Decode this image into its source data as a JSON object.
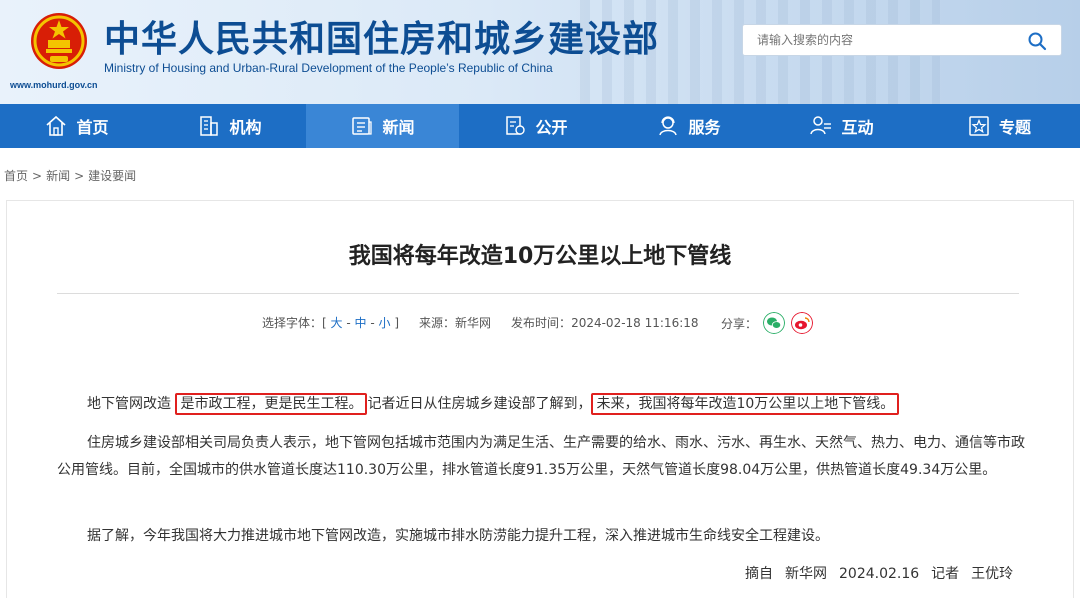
{
  "header": {
    "title_cn": "中华人民共和国住房和城乡建设部",
    "title_en": "Ministry of Housing and Urban-Rural Development of the People’s Republic of China",
    "url": "www.mohurd.gov.cn",
    "emblem_icon": "national-emblem-icon"
  },
  "search": {
    "placeholder": "请输入搜索的内容",
    "icon": "search-icon"
  },
  "nav": {
    "items": [
      {
        "label": "首页",
        "icon": "home-icon"
      },
      {
        "label": "机构",
        "icon": "building-icon"
      },
      {
        "label": "新闻",
        "icon": "news-icon",
        "active": true
      },
      {
        "label": "公开",
        "icon": "document-icon"
      },
      {
        "label": "服务",
        "icon": "service-icon"
      },
      {
        "label": "互动",
        "icon": "interaction-icon"
      },
      {
        "label": "专题",
        "icon": "topic-icon"
      }
    ]
  },
  "breadcrumb": [
    "首页",
    "新闻",
    "建设要闻"
  ],
  "article": {
    "title": "我国将每年改造10万公里以上地下管线",
    "meta": {
      "font_label": "选择字体：[",
      "font_large": "大",
      "font_medium": "中",
      "font_small": "小",
      "font_close": "]",
      "source_label": "来源：",
      "source": "新华网",
      "time_label": "发布时间：",
      "time": "2024-02-18 11:16:18"
    },
    "share_label": "分享：",
    "p1_a": "地下管网改造",
    "p1_hl1": "是市政工程，更是民生工程。",
    "p1_b": "记者近日从住房城乡建设部了解到，",
    "p1_hl2": "未来，我国将每年改造10万公里以上地下管线。",
    "p2": "住房城乡建设部相关司局负责人表示，地下管网包括城市范围内为满足生活、生产需要的给水、雨水、污水、再生水、天然气、热力、电力、通信等市政公用管线。目前，全国城市的供水管道长度达110.30万公里，排水管道长度91.35万公里，天然气管道长度98.04万公里，供热管道长度49.34万公里。",
    "p3": "据了解，今年我国将大力推进城市地下管网改造，实施城市排水防涝能力提升工程，深入推进城市生命线安全工程建设。",
    "credit": {
      "from_label": "摘自",
      "from": "新华网",
      "date": "2024.02.16",
      "reporter_label": "记者",
      "reporter": "王优玲"
    }
  },
  "colors": {
    "nav_bg": "#1d6ec5",
    "nav_active": "#3a86d6",
    "title_blue": "#0d4d93",
    "highlight_red": "#e0201e"
  }
}
